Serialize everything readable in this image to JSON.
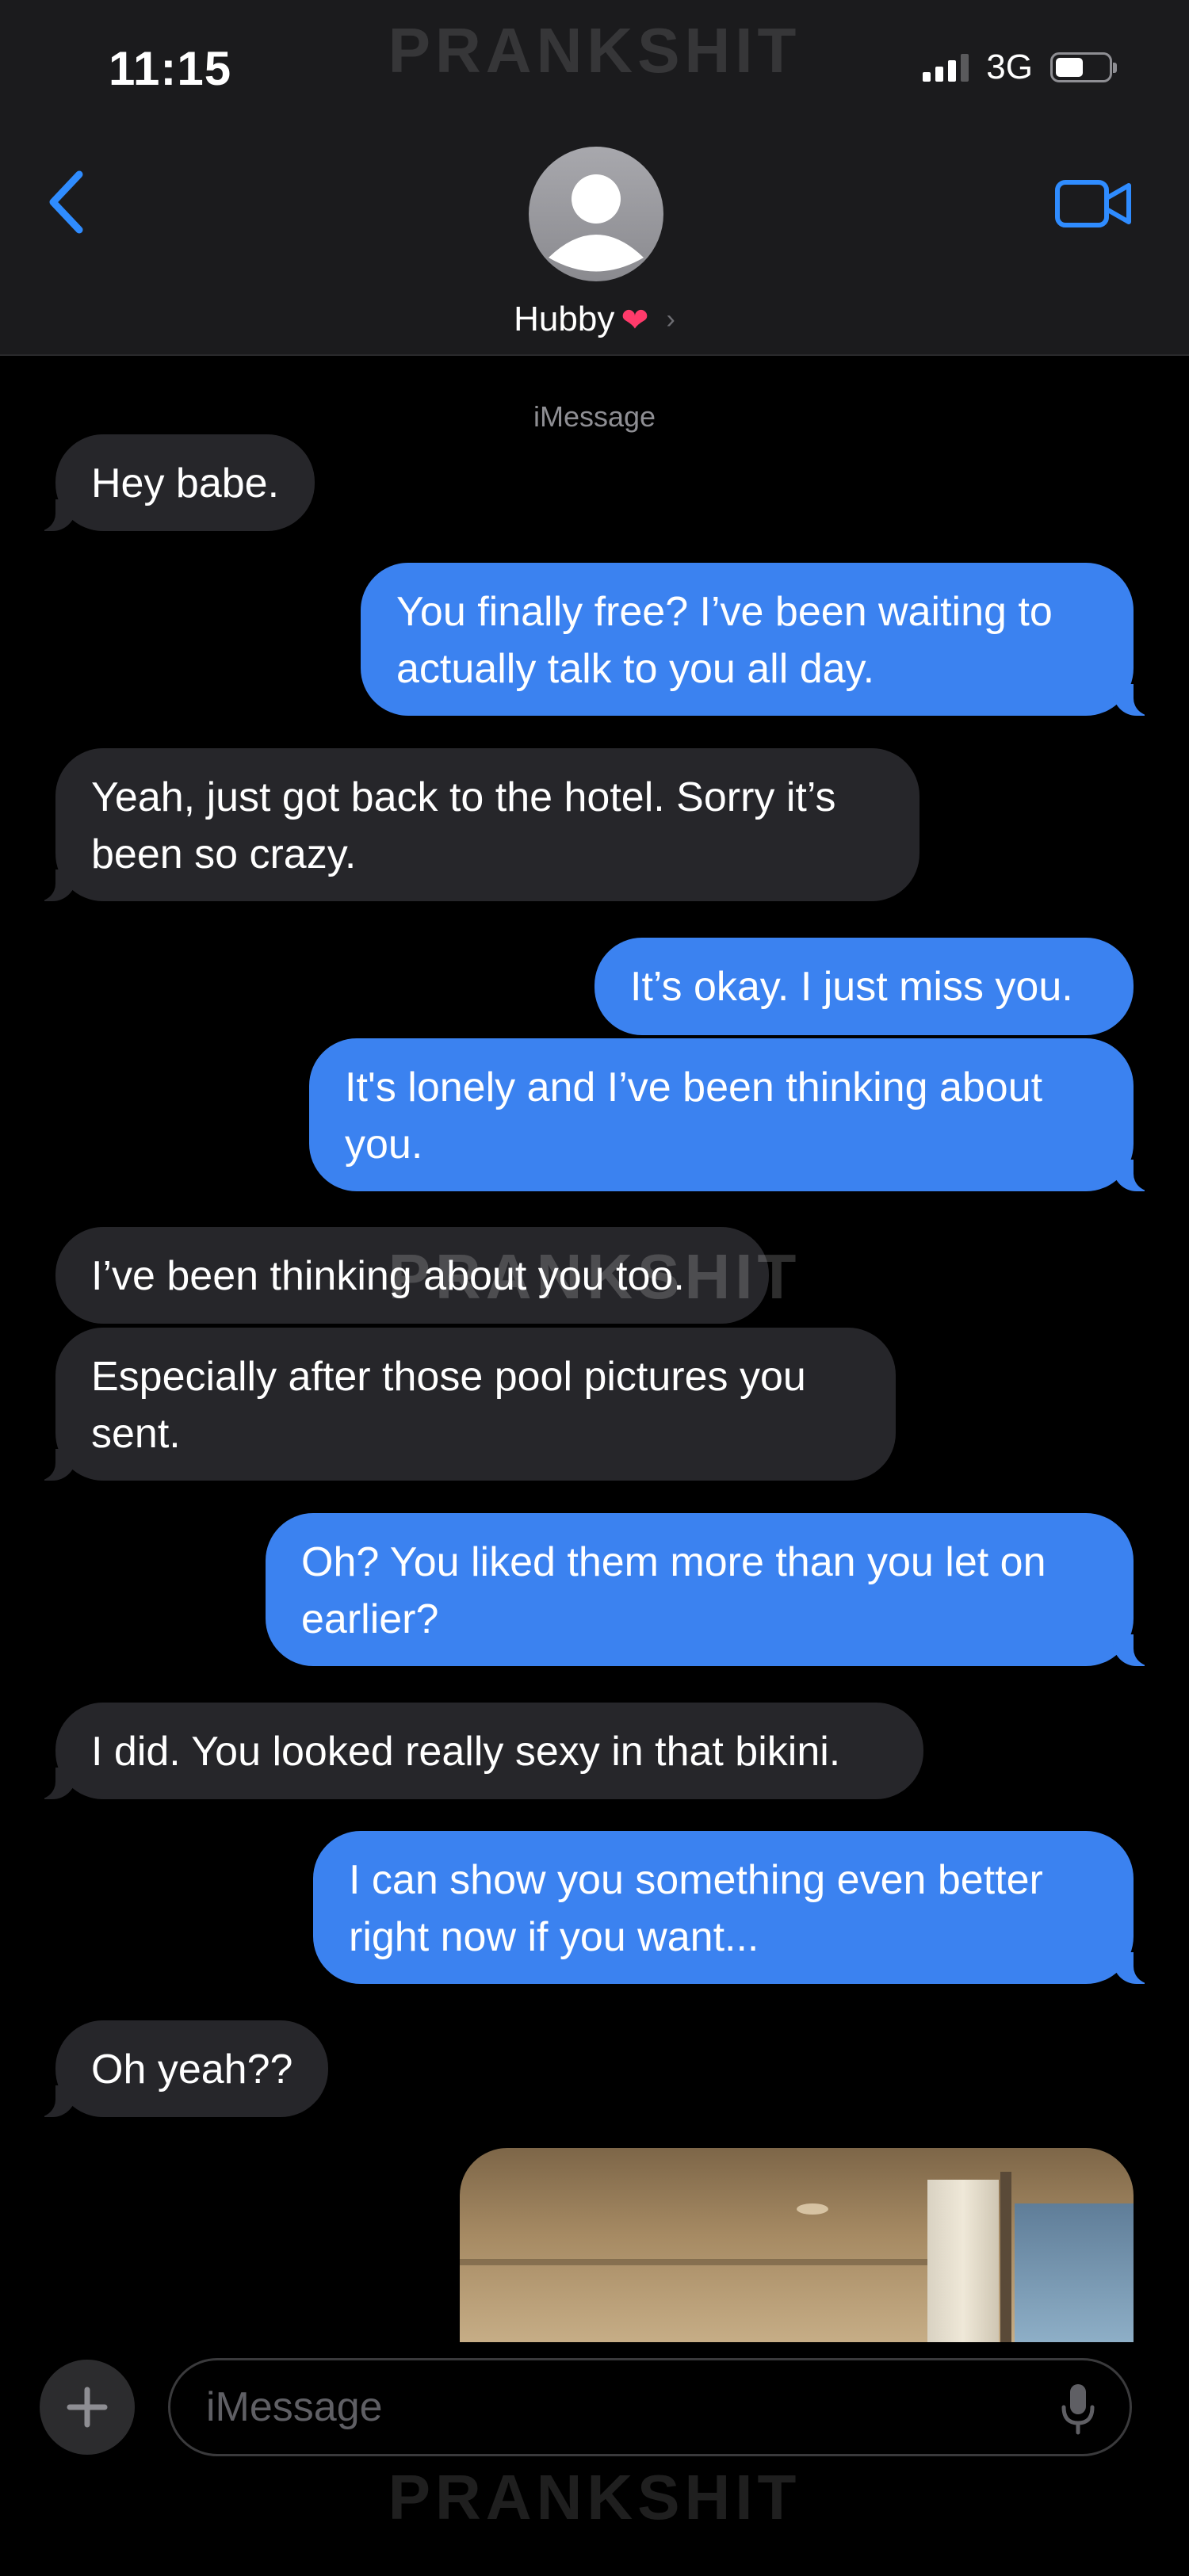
{
  "status_bar": {
    "time": "11:15",
    "network": "3G"
  },
  "watermark": "PRANKSHIT",
  "header": {
    "contact_name": "Hubby",
    "heart": "❤",
    "chevron": "›"
  },
  "conversation": {
    "service_label": "iMessage",
    "messages": [
      {
        "from": "contact",
        "text": "Hey babe."
      },
      {
        "from": "me",
        "text": "You finally free? I’ve been waiting to\nactually talk to you all day."
      },
      {
        "from": "contact",
        "text": "Yeah, just got back to the hotel. Sorry it’s\nbeen so crazy."
      },
      {
        "from": "me",
        "text": "It’s okay. I just miss you."
      },
      {
        "from": "me",
        "text": "It's lonely and I’ve been thinking about\nyou."
      },
      {
        "from": "contact",
        "text": "I’ve been thinking about you too."
      },
      {
        "from": "contact",
        "text": "Especially after those pool pictures you\nsent."
      },
      {
        "from": "me",
        "text": "Oh? You liked them more than you let on\nearlier?"
      },
      {
        "from": "contact",
        "text": "I did. You looked really sexy in that bikini."
      },
      {
        "from": "me",
        "text": "I can show you something even better\nright now if you want..."
      },
      {
        "from": "contact",
        "text": "Oh yeah??"
      }
    ]
  },
  "composer": {
    "placeholder": "iMessage"
  },
  "colors": {
    "sent": "#3b82f0",
    "received": "#26262a",
    "accent": "#2f8cff",
    "background": "#000000"
  },
  "icons": [
    "back-chevron-icon",
    "video-camera-icon",
    "avatar-person-icon",
    "plus-icon",
    "microphone-icon",
    "heart-icon"
  ]
}
